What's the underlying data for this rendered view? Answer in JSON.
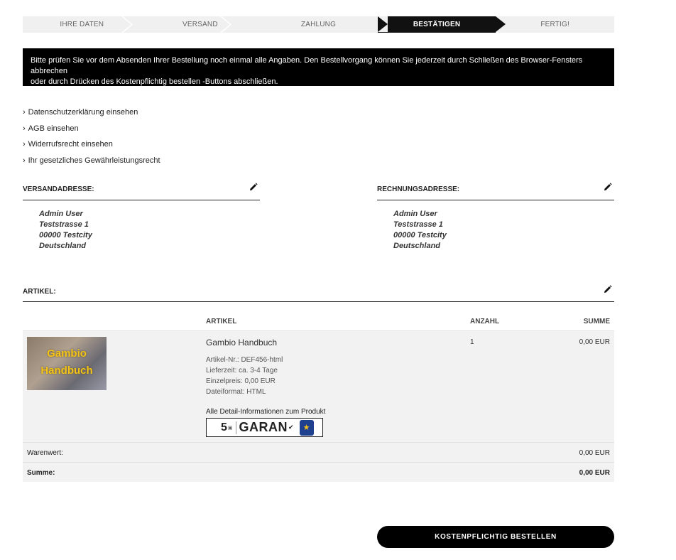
{
  "steps": [
    {
      "label": "IHRE DATEN",
      "active": false
    },
    {
      "label": "VERSAND",
      "active": false
    },
    {
      "label": "ZAHLUNG",
      "active": false
    },
    {
      "label": "BESTÄTIGEN",
      "active": true
    },
    {
      "label": "FERTIG!",
      "active": false
    }
  ],
  "notice": {
    "line1": "Bitte prüfen Sie vor dem Absenden Ihrer Bestellung noch einmal alle Angaben. Den Bestellvorgang können Sie jederzeit durch Schließen des Browser-Fensters abbrechen",
    "line2": "oder durch Drücken des Kostenpflichtig bestellen -Buttons abschließen."
  },
  "links": [
    "Datenschutzerklärung einsehen",
    "AGB einsehen",
    "Widerrufsrecht einsehen",
    "Ihr gesetzliches Gewährleistungsrecht"
  ],
  "shipping": {
    "title": "VERSANDADRESSE:",
    "name": "Admin User",
    "street": "Teststrasse 1",
    "city": "00000 Testcity",
    "country": "Deutschland"
  },
  "billing": {
    "title": "RECHNUNGSADRESSE:",
    "name": "Admin User",
    "street": "Teststrasse 1",
    "city": "00000 Testcity",
    "country": "Deutschland"
  },
  "articles": {
    "title": "ARTIKEL:",
    "columns": {
      "article": "ARTIKEL",
      "qty": "ANZAHL",
      "sum": "SUMME"
    },
    "item": {
      "thumb_line1": "Gambio",
      "thumb_line2": "Handbuch",
      "name": "Gambio Handbuch",
      "sku": "Artikel-Nr.: DEF456-html",
      "delivery": "Lieferzeit: ca. 3-4 Tage",
      "unit_price": "Einzelpreis: 0,00 EUR",
      "format": "Dateiformat: HTML",
      "detail_link": "Alle Detail-Informationen zum Produkt",
      "badge_number": "5",
      "badge_word": "GARAN",
      "qty": "1",
      "sum": "0,00 EUR"
    }
  },
  "totals": {
    "subtotal_label": "Warenwert:",
    "subtotal_value": "0,00 EUR",
    "total_label": "Summe:",
    "total_value": "0,00 EUR"
  },
  "order_button": "KOSTENPFLICHTIG BESTELLEN"
}
